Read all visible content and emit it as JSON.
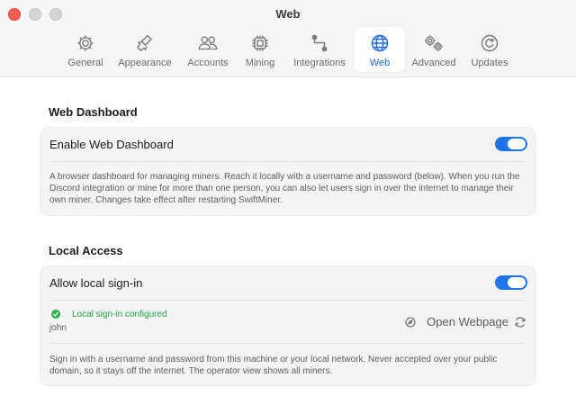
{
  "window": {
    "title": "Web"
  },
  "toolbar": {
    "tabs": [
      {
        "label": "General",
        "icon": "gear-icon"
      },
      {
        "label": "Appearance",
        "icon": "paintbrush-icon"
      },
      {
        "label": "Accounts",
        "icon": "people-icon"
      },
      {
        "label": "Mining",
        "icon": "chip-icon"
      },
      {
        "label": "Integrations",
        "icon": "connection-icon"
      },
      {
        "label": "Web",
        "icon": "globe-icon",
        "selected": true
      },
      {
        "label": "Advanced",
        "icon": "gears-icon"
      },
      {
        "label": "Updates",
        "icon": "refresh-icon"
      }
    ]
  },
  "web_dashboard": {
    "title": "Web Dashboard",
    "toggle_label": "Enable Web Dashboard",
    "enabled": true,
    "description": "A browser dashboard for managing miners. Reach it locally with a username and password (below). When you run the Discord integration or mine for more than one person, you can also let users sign in over the internet to manage their own miner. Changes take effect after restarting SwiftMiner."
  },
  "local_access": {
    "title": "Local Access",
    "toggle_label": "Allow local sign-in",
    "enabled": true,
    "status_text": "Local sign-in configured",
    "username": "john",
    "open_label": "Open Webpage",
    "description": "Sign in with a username and password from this machine or your local network. Never accepted over your public domain, so it stays off the internet. The operator view shows all miners."
  },
  "colors": {
    "accent": "#1f74e8",
    "success": "#2ab24c",
    "close": "#ff5f57"
  }
}
